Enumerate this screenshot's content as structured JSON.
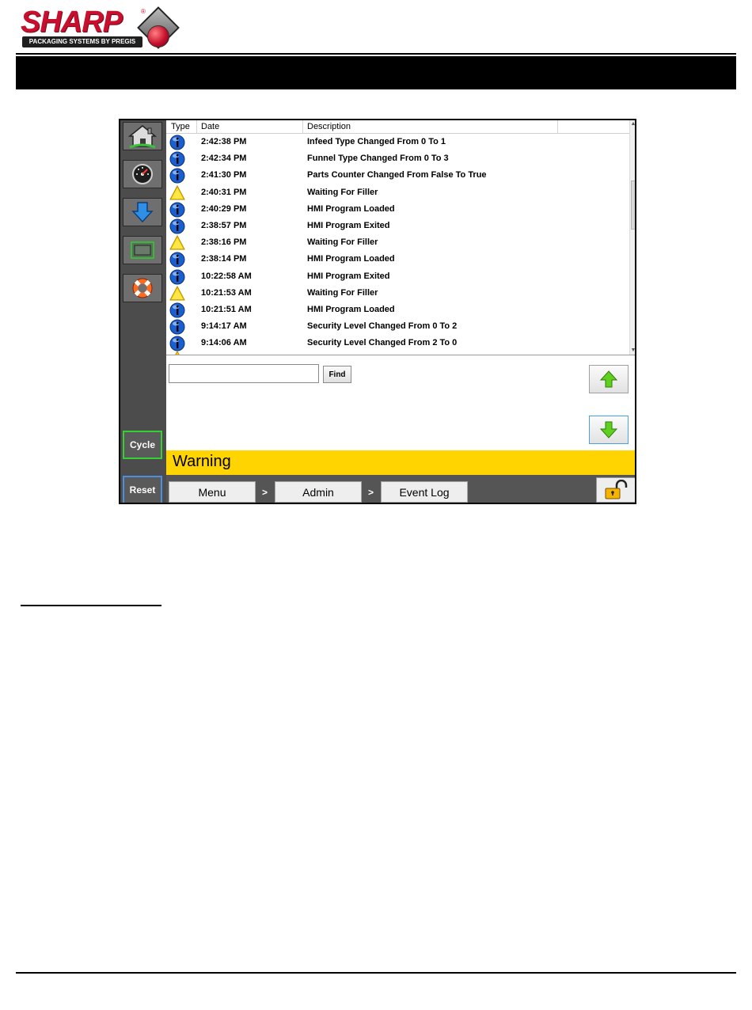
{
  "logo": {
    "word": "SHARP",
    "reg": "®",
    "tagline": "PACKAGING SYSTEMS BY PREGIS"
  },
  "hmi": {
    "sidebar": {
      "icons": [
        "home-icon",
        "gauge-icon",
        "download-arrow-icon",
        "printer-tray-icon",
        "lifebuoy-icon"
      ],
      "cycle_label": "Cycle",
      "reset_label": "Reset"
    },
    "event_log": {
      "columns": {
        "type": "Type",
        "date": "Date",
        "description": "Description"
      },
      "rows": [
        {
          "type": "info-icon",
          "date": "2:42:38 PM",
          "description": "Infeed Type Changed From 0 To 1"
        },
        {
          "type": "info-icon",
          "date": "2:42:34 PM",
          "description": "Funnel Type Changed From 0 To 3"
        },
        {
          "type": "info-icon",
          "date": "2:41:30 PM",
          "description": "Parts Counter Changed From False To True"
        },
        {
          "type": "warning-icon",
          "date": "2:40:31 PM",
          "description": "Waiting For Filler"
        },
        {
          "type": "info-icon",
          "date": "2:40:29 PM",
          "description": "HMI Program Loaded"
        },
        {
          "type": "info-icon",
          "date": "2:38:57 PM",
          "description": "HMI Program Exited"
        },
        {
          "type": "warning-icon",
          "date": "2:38:16 PM",
          "description": "Waiting For Filler"
        },
        {
          "type": "info-icon",
          "date": "2:38:14 PM",
          "description": "HMI Program Loaded"
        },
        {
          "type": "info-icon",
          "date": "10:22:58 AM",
          "description": "HMI Program Exited"
        },
        {
          "type": "warning-icon",
          "date": "10:21:53 AM",
          "description": "Waiting For Filler"
        },
        {
          "type": "info-icon",
          "date": "10:21:51 AM",
          "description": "HMI Program Loaded"
        },
        {
          "type": "info-icon",
          "date": "9:14:17 AM",
          "description": "Security Level Changed From 0 To 2"
        },
        {
          "type": "info-icon",
          "date": "9:14:06 AM",
          "description": "Security Level Changed From 2 To 0"
        }
      ]
    },
    "search": {
      "value": "",
      "placeholder": "",
      "find_label": "Find"
    },
    "status": {
      "text": "Warning",
      "color": "#ffd400"
    },
    "breadcrumb": [
      "Menu",
      "Admin",
      "Event Log"
    ],
    "breadcrumb_separator": ">",
    "lock_icon": "unlocked-padlock-icon",
    "colors": {
      "info": "#1a5fd0",
      "warning": "#ffd400",
      "cycle_border": "#35d035",
      "reset_border": "#4c8fe0",
      "arrow_green": "#5fd020"
    }
  }
}
